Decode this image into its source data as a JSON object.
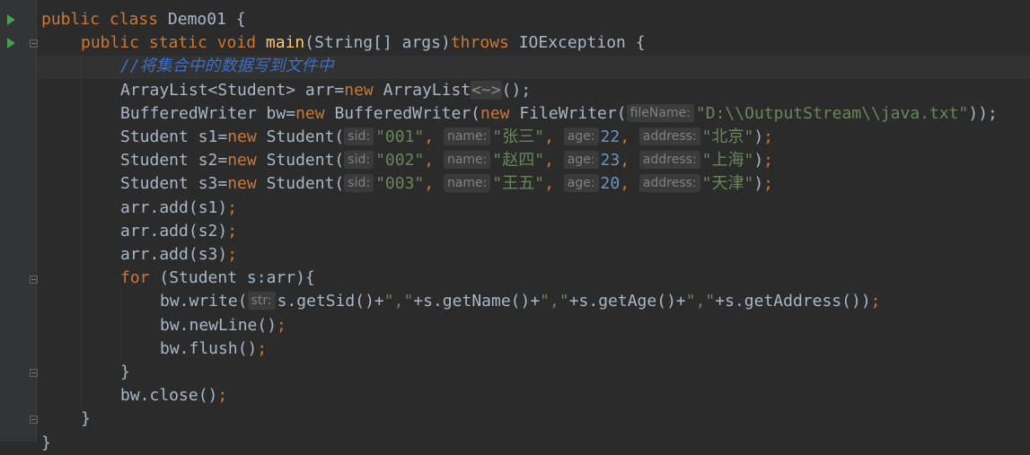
{
  "editor": {
    "lines": [
      {
        "indent": 0,
        "tokens": [
          [
            "kw",
            "public class "
          ],
          [
            "p",
            "Demo01 {"
          ]
        ]
      },
      {
        "indent": 1,
        "tokens": [
          [
            "kw",
            "public static void "
          ],
          [
            "fn",
            "main"
          ],
          [
            "p",
            "(String[] args)"
          ],
          [
            "kw",
            "throws "
          ],
          [
            "p",
            "IOException {"
          ]
        ]
      },
      {
        "indent": 2,
        "tokens": [
          [
            "cmt",
            "//将集合中的数据写到文件中"
          ]
        ]
      },
      {
        "indent": 2,
        "tokens": [
          [
            "p",
            "ArrayList<Student> arr="
          ],
          [
            "kw",
            "new "
          ],
          [
            "p",
            "ArrayList"
          ],
          [
            "fold",
            "<~>"
          ],
          [
            "p",
            "();"
          ]
        ]
      },
      {
        "indent": 2,
        "tokens": [
          [
            "p",
            "BufferedWriter bw="
          ],
          [
            "kw",
            "new "
          ],
          [
            "p",
            "BufferedWriter("
          ],
          [
            "kw",
            "new "
          ],
          [
            "p",
            "FileWriter("
          ],
          [
            "hint",
            "fileName:"
          ],
          [
            "str",
            "\"D:\\\\OutputStream\\\\java.txt\""
          ],
          [
            "p",
            "));"
          ]
        ]
      },
      {
        "indent": 2,
        "tokens": [
          [
            "p",
            "Student s1="
          ],
          [
            "kw",
            "new "
          ],
          [
            "p",
            "Student("
          ],
          [
            "hint",
            "sid:"
          ],
          [
            "str",
            "\"001\""
          ],
          [
            "kw",
            ", "
          ],
          [
            "hint",
            "name:"
          ],
          [
            "str",
            "\"张三\""
          ],
          [
            "kw",
            ", "
          ],
          [
            "hint",
            "age:"
          ],
          [
            "num",
            "22"
          ],
          [
            "kw",
            ", "
          ],
          [
            "hint",
            "address:"
          ],
          [
            "str",
            "\"北京\""
          ],
          [
            "p",
            ")"
          ],
          [
            "kw",
            ";"
          ]
        ]
      },
      {
        "indent": 2,
        "tokens": [
          [
            "p",
            "Student s2="
          ],
          [
            "kw",
            "new "
          ],
          [
            "p",
            "Student("
          ],
          [
            "hint",
            "sid:"
          ],
          [
            "str",
            "\"002\""
          ],
          [
            "kw",
            ", "
          ],
          [
            "hint",
            "name:"
          ],
          [
            "str",
            "\"赵四\""
          ],
          [
            "kw",
            ", "
          ],
          [
            "hint",
            "age:"
          ],
          [
            "num",
            "23"
          ],
          [
            "kw",
            ", "
          ],
          [
            "hint",
            "address:"
          ],
          [
            "str",
            "\"上海\""
          ],
          [
            "p",
            ")"
          ],
          [
            "kw",
            ";"
          ]
        ]
      },
      {
        "indent": 2,
        "tokens": [
          [
            "p",
            "Student s3="
          ],
          [
            "kw",
            "new "
          ],
          [
            "p",
            "Student("
          ],
          [
            "hint",
            "sid:"
          ],
          [
            "str",
            "\"003\""
          ],
          [
            "kw",
            ", "
          ],
          [
            "hint",
            "name:"
          ],
          [
            "str",
            "\"王五\""
          ],
          [
            "kw",
            ", "
          ],
          [
            "hint",
            "age:"
          ],
          [
            "num",
            "20"
          ],
          [
            "kw",
            ", "
          ],
          [
            "hint",
            "address:"
          ],
          [
            "str",
            "\"天津\""
          ],
          [
            "p",
            ")"
          ],
          [
            "kw",
            ";"
          ]
        ]
      },
      {
        "indent": 2,
        "tokens": [
          [
            "p",
            "arr.add(s1)"
          ],
          [
            "kw",
            ";"
          ]
        ]
      },
      {
        "indent": 2,
        "tokens": [
          [
            "p",
            "arr.add(s2)"
          ],
          [
            "kw",
            ";"
          ]
        ]
      },
      {
        "indent": 2,
        "tokens": [
          [
            "p",
            "arr.add(s3)"
          ],
          [
            "kw",
            ";"
          ]
        ]
      },
      {
        "indent": 2,
        "tokens": [
          [
            "kw",
            "for "
          ],
          [
            "p",
            "(Student s:arr){"
          ]
        ]
      },
      {
        "indent": 3,
        "tokens": [
          [
            "p",
            "bw.write("
          ],
          [
            "hint",
            "str:"
          ],
          [
            "p",
            "s.getSid()+"
          ],
          [
            "str",
            "\",\""
          ],
          [
            "p",
            "+s.getName()+"
          ],
          [
            "str",
            "\",\""
          ],
          [
            "p",
            "+s.getAge()+"
          ],
          [
            "str",
            "\",\""
          ],
          [
            "p",
            "+s.getAddress())"
          ],
          [
            "kw",
            ";"
          ]
        ]
      },
      {
        "indent": 3,
        "tokens": [
          [
            "p",
            "bw.newLine()"
          ],
          [
            "kw",
            ";"
          ]
        ]
      },
      {
        "indent": 3,
        "tokens": [
          [
            "p",
            "bw.flush()"
          ],
          [
            "kw",
            ";"
          ]
        ]
      },
      {
        "indent": 2,
        "tokens": [
          [
            "p",
            "}"
          ]
        ]
      },
      {
        "indent": 2,
        "tokens": [
          [
            "p",
            "bw.close()"
          ],
          [
            "kw",
            ";"
          ]
        ]
      },
      {
        "indent": 1,
        "tokens": [
          [
            "p",
            "}"
          ]
        ]
      },
      {
        "indent": 0,
        "tokens": [
          [
            "p",
            "}"
          ]
        ]
      }
    ]
  },
  "colors": {
    "background": "#2b2b2b",
    "gutter": "#313335",
    "keyword": "#cc7832",
    "method": "#ffc66d",
    "string": "#6a8759",
    "number": "#6897bb",
    "comment": "#3d6fc8",
    "plain": "#a9b7c6",
    "hint_bg": "#3b3b3b",
    "hint_text": "#808080",
    "run_icon": "#499c54"
  },
  "gutter": {
    "run_icons": [
      "run-class-icon",
      "run-method-icon"
    ],
    "fold_icons": [
      "fold-method-icon",
      "fold-for-icon",
      "fold-for-end-icon",
      "fold-method-end-icon"
    ]
  }
}
